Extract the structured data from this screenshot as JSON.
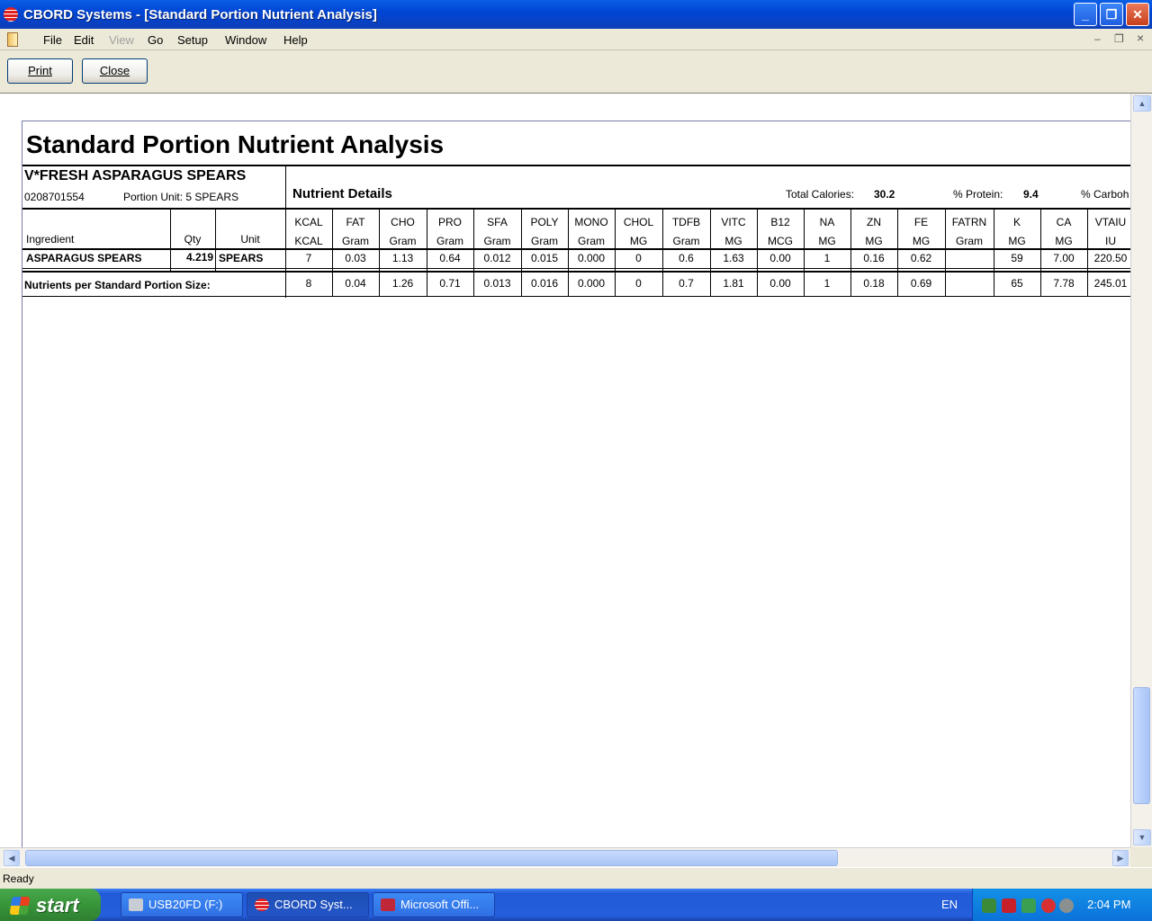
{
  "window": {
    "title": "CBORD Systems - [Standard Portion Nutrient Analysis]",
    "min_glyph": "_",
    "max_glyph": "❐",
    "close_glyph": "✕"
  },
  "menu": {
    "items": [
      "File",
      "Edit",
      "View",
      "Go",
      "Setup",
      "Window",
      "Help"
    ],
    "mdi_min": "–",
    "mdi_restore": "❐",
    "mdi_close": "×"
  },
  "toolbar": {
    "print_label": "Print",
    "close_label": "Close"
  },
  "report": {
    "title": "Standard Portion Nutrient Analysis",
    "item_name": "V*FRESH ASPARAGUS SPEARS",
    "item_code": "0208701554",
    "portion_unit_label": "Portion Unit:",
    "portion_unit_value": "5 SPEARS",
    "nutrient_details_label": "Nutrient Details",
    "total_calories_label": "Total Calories:",
    "total_calories_value": "30.2",
    "protein_label": "% Protein:",
    "protein_value": "9.4",
    "carb_label": "% Carboh",
    "headers": {
      "ingredient": "Ingredient",
      "qty": "Qty",
      "unit": "Unit"
    },
    "nutrients": [
      {
        "name": "KCAL",
        "unit": "KCAL"
      },
      {
        "name": "FAT",
        "unit": "Gram"
      },
      {
        "name": "CHO",
        "unit": "Gram"
      },
      {
        "name": "PRO",
        "unit": "Gram"
      },
      {
        "name": "SFA",
        "unit": "Gram"
      },
      {
        "name": "POLY",
        "unit": "Gram"
      },
      {
        "name": "MONO",
        "unit": "Gram"
      },
      {
        "name": "CHOL",
        "unit": "MG"
      },
      {
        "name": "TDFB",
        "unit": "Gram"
      },
      {
        "name": "VITC",
        "unit": "MG"
      },
      {
        "name": "B12",
        "unit": "MCG"
      },
      {
        "name": "NA",
        "unit": "MG"
      },
      {
        "name": "ZN",
        "unit": "MG"
      },
      {
        "name": "FE",
        "unit": "MG"
      },
      {
        "name": "FATRN",
        "unit": "Gram"
      },
      {
        "name": "K",
        "unit": "MG"
      },
      {
        "name": "CA",
        "unit": "MG"
      },
      {
        "name": "VTAIU",
        "unit": "IU"
      }
    ],
    "ingredient_row": {
      "name": "ASPARAGUS SPEARS",
      "qty": "4.219",
      "unit": "SPEARS",
      "values": [
        "7",
        "0.03",
        "1.13",
        "0.64",
        "0.012",
        "0.015",
        "0.000",
        "0",
        "0.6",
        "1.63",
        "0.00",
        "1",
        "0.16",
        "0.62",
        "",
        "59",
        "7.00",
        "220.50"
      ]
    },
    "total_row": {
      "label": "Nutrients per Standard Portion Size:",
      "values": [
        "8",
        "0.04",
        "1.26",
        "0.71",
        "0.013",
        "0.016",
        "0.000",
        "0",
        "0.7",
        "1.81",
        "0.00",
        "1",
        "0.18",
        "0.69",
        "",
        "65",
        "7.78",
        "245.01"
      ]
    }
  },
  "scroll": {
    "up": "▲",
    "down": "▼",
    "left": "◀",
    "right": "▶"
  },
  "status": {
    "text": "Ready"
  },
  "taskbar": {
    "start_label": "start",
    "tasks": [
      {
        "label": "USB20FD (F:)"
      },
      {
        "label": "CBORD Syst..."
      },
      {
        "label": "Microsoft Offi..."
      }
    ],
    "lang": "EN",
    "clock": "2:04 PM"
  }
}
